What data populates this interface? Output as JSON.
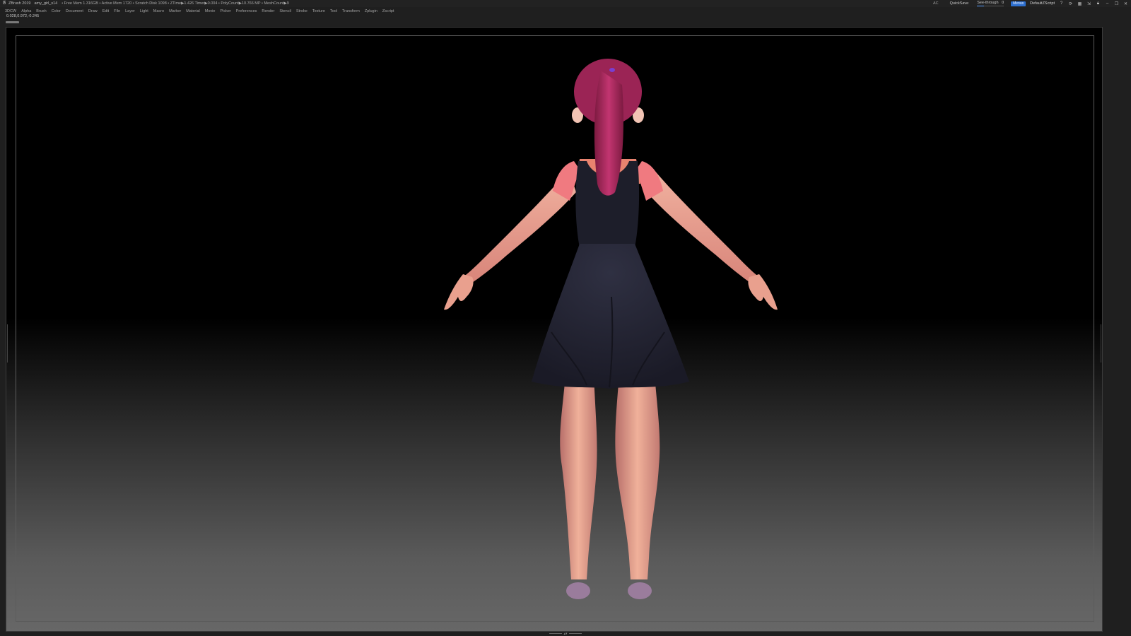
{
  "titlebar": {
    "app": "ZBrush 2019",
    "file": "amy_girl_s14",
    "stats": "• Free Mem 1.316GB • Active Mem 1720 • Scratch Disk 1098 • ZTime▶1.426 Timer▶0.004 • PolyCount▶10.766 MP • MeshCount▶9",
    "ac": "AC",
    "quicksave": "QuickSave",
    "see_through_label": "See-through",
    "see_through_value": "0",
    "see_through_level": 0.25,
    "menus": "Menus",
    "script": "DefaultZScript"
  },
  "menubar": {
    "items": [
      "3DCW",
      "Alpha",
      "Brush",
      "Color",
      "Document",
      "Draw",
      "Edit",
      "File",
      "Layer",
      "Light",
      "Macro",
      "Marker",
      "Material",
      "Movie",
      "Picker",
      "Preferences",
      "Render",
      "Stencil",
      "Stroke",
      "Texture",
      "Tool",
      "Transform",
      "Zplugin",
      "Zscript"
    ]
  },
  "coords": "0.028,0.972,-0.245",
  "colors": {
    "background": "#1f1f1f",
    "accent": "#2d6fcf",
    "dress": "#232433",
    "hair": "#a42a5a",
    "skin": "#e7a08d"
  },
  "icons": {
    "app": "zbrush-logo-icon",
    "window": [
      "help-icon",
      "sync-icon",
      "layout-icon",
      "dock-icon",
      "lock-icon",
      "minimize-icon",
      "restore-icon",
      "close-icon"
    ]
  }
}
